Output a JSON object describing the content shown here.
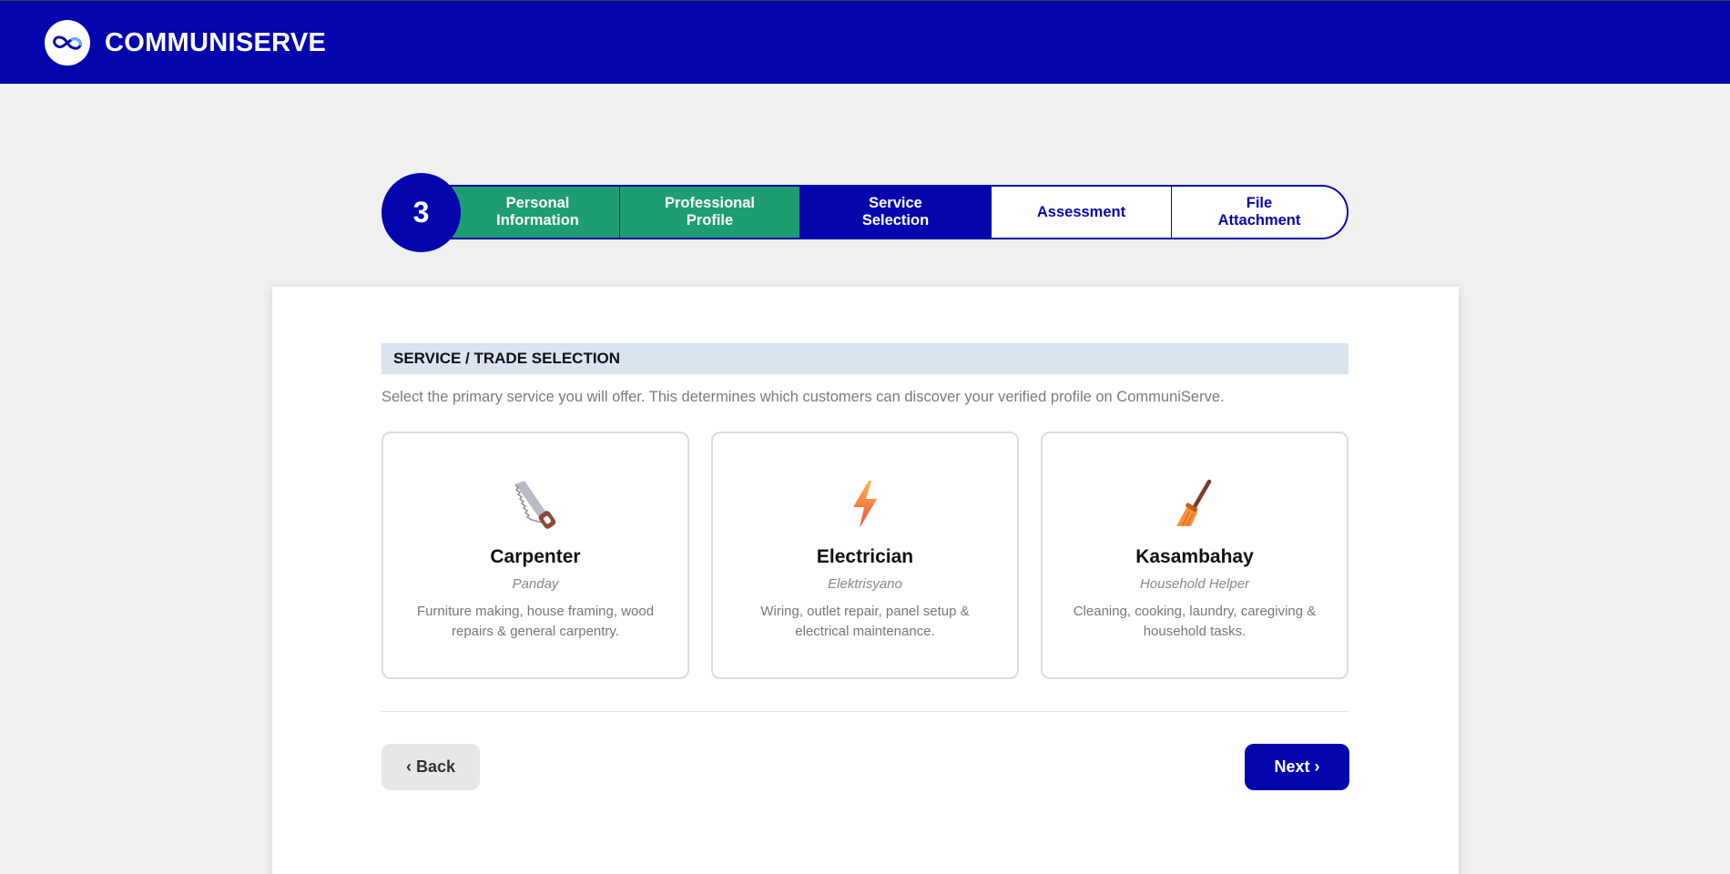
{
  "header": {
    "logo_icon": "cs-infinity-logo-icon",
    "brand": "COMMUNISERVE",
    "brand_color": "#0505ad"
  },
  "stepper": {
    "current_number": "3",
    "steps": [
      {
        "label": "Personal\nInformation",
        "state": "done"
      },
      {
        "label": "Professional\nProfile",
        "state": "done"
      },
      {
        "label": "Service\nSelection",
        "state": "current"
      },
      {
        "label": "Assessment",
        "state": "todo"
      },
      {
        "label": "File\nAttachment",
        "state": "todo"
      }
    ],
    "colors": {
      "done": "#1e9e70",
      "current": "#0505ad",
      "todo": "#ffffff"
    }
  },
  "section": {
    "title": "SERVICE / TRADE SELECTION",
    "description": "Select the primary service you will offer. This determines which customers can discover your verified profile on CommuniServe."
  },
  "services": [
    {
      "icon": "saw-icon",
      "name": "Carpenter",
      "sub": "Panday",
      "desc": "Furniture making, house framing, wood repairs & general carpentry."
    },
    {
      "icon": "lightning-bolt-icon",
      "name": "Electrician",
      "sub": "Elektrisyano",
      "desc": "Wiring, outlet repair, panel setup & electrical maintenance."
    },
    {
      "icon": "broom-icon",
      "name": "Kasambahay",
      "sub": "Household Helper",
      "desc": "Cleaning, cooking, laundry, caregiving & household tasks."
    }
  ],
  "actions": {
    "back_label": "‹ Back",
    "next_label": "Next ›"
  }
}
